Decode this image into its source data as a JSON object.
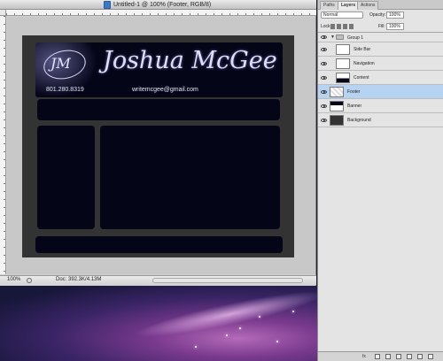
{
  "document": {
    "title": "Untitled-1 @ 100% (Footer, RGB/8)",
    "zoom": "100%",
    "doc_info": "Doc: 392.3K/4.13M"
  },
  "canvas": {
    "logo_initials": "JM",
    "brand_name": "Joshua McGee",
    "phone": "801.280.8319",
    "email": "writemcgee@gmail.com"
  },
  "layers_panel": {
    "tabs": [
      {
        "label": "Paths",
        "active": false
      },
      {
        "label": "Layers",
        "active": true
      },
      {
        "label": "Actions",
        "active": false
      }
    ],
    "blend_mode": "Normal",
    "opacity_label": "Opacity:",
    "opacity_value": "100%",
    "lock_label": "Lock:",
    "fill_label": "Fill:",
    "fill_value": "100%",
    "layers": [
      {
        "name": "Group 1",
        "type": "group",
        "selected": false
      },
      {
        "name": "Side Bar",
        "type": "layer",
        "selected": false
      },
      {
        "name": "Navigation",
        "type": "layer",
        "selected": false
      },
      {
        "name": "Content",
        "type": "layer",
        "selected": false
      },
      {
        "name": "Footer",
        "type": "layer",
        "selected": true
      },
      {
        "name": "Banner",
        "type": "layer",
        "selected": false
      },
      {
        "name": "Background",
        "type": "layer",
        "selected": false
      }
    ],
    "link_label": "fx"
  },
  "colors": {
    "canvas_background": "#333333",
    "box_fill": "#050518",
    "selection_highlight": "#b6d3f2"
  },
  "icons": [
    "document-icon",
    "eye-icon",
    "folder-icon",
    "lock-icon",
    "status-menu-icon"
  ]
}
